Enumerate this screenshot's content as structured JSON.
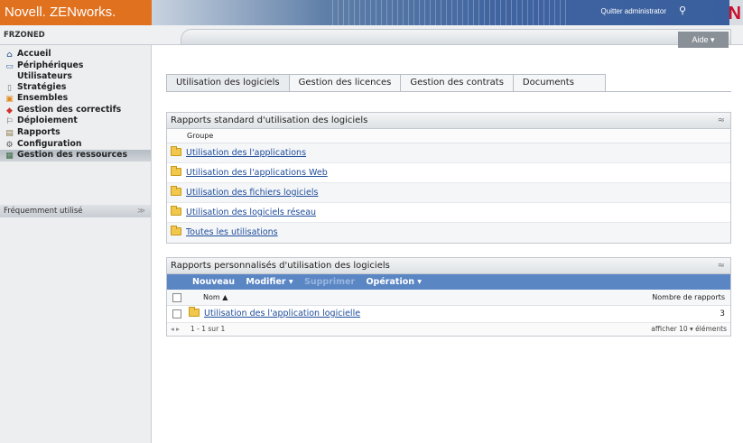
{
  "header": {
    "brand": "Novell. ZENworks.",
    "quit_label": "Quitter administrator",
    "key_icon": "key-icon",
    "logo_letter": "N",
    "zone": "FRZONED",
    "help_label": "Aide ▾"
  },
  "sidebar": {
    "items": [
      {
        "label": "Accueil",
        "icon": "⌂"
      },
      {
        "label": "Périphériques",
        "label2": "Utilisateurs",
        "icon": "▭"
      },
      {
        "label": "Stratégies",
        "icon": "▯"
      },
      {
        "label": "Ensembles",
        "icon": "▣"
      },
      {
        "label": "Gestion des correctifs",
        "icon": "◆"
      },
      {
        "label": "Déploiement",
        "icon": "⚐"
      },
      {
        "label": "Rapports",
        "icon": "▤"
      },
      {
        "label": "Configuration",
        "icon": "⚙"
      },
      {
        "label": "Gestion des ressources",
        "icon": "▦"
      }
    ],
    "frequent_label": "Fréquemment utilisé",
    "frequent_chevron": "≫"
  },
  "tabs": [
    {
      "label": "Utilisation des logiciels"
    },
    {
      "label": "Gestion des licences"
    },
    {
      "label": "Gestion des contrats"
    },
    {
      "label": "Documents"
    }
  ],
  "standard_panel": {
    "title": "Rapports standard d'utilisation des logiciels",
    "collapse": "≈",
    "column": "Groupe",
    "rows": [
      "Utilisation des l'applications",
      "Utilisation des l'applications Web",
      "Utilisation des fichiers logiciels",
      "Utilisation des logiciels réseau",
      "Toutes les utilisations"
    ]
  },
  "custom_panel": {
    "title": "Rapports personnalisés d'utilisation des logiciels",
    "collapse": "≈",
    "actions": {
      "new": "Nouveau",
      "edit": "Modifier ▾",
      "delete": "Supprimer",
      "operation": "Opération ▾"
    },
    "col_name": "Nom ▲",
    "col_count": "Nombre de rapports",
    "rows": [
      {
        "name": "Utilisation des l'application logicielle",
        "count": "3"
      }
    ],
    "pager": {
      "arrows": "◂ ▸",
      "range": "1 - 1 sur 1",
      "show": "afficher 10 ▾ éléments"
    }
  }
}
